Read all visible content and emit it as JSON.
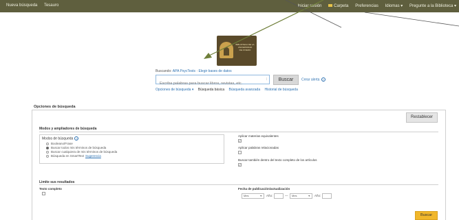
{
  "topbar": {
    "left": [
      "Nueva búsqueda",
      "Tesauro"
    ],
    "right": [
      "Carpeta",
      "Preferencias",
      "Idiomas",
      "Pregunte a la Biblioteca"
    ],
    "right_lead": "Iniciar sesión"
  },
  "logo": {
    "lines": [
      "BIBLIOTECA DE LA",
      "UNIVERSIDAD",
      "DE OVIEDO"
    ]
  },
  "search": {
    "buscando_label": "Buscando:",
    "db_name": "APA PsycTests",
    "choose_db": "Elegir bases de datos",
    "placeholder": "Escriba palabras para buscar libros, revistas, etc.",
    "button": "Buscar",
    "create_alert": "Crear alerta",
    "options": [
      "Opciones de búsqueda",
      "Búsqueda básica",
      "Búsqueda avanzada",
      "Historial de búsqueda"
    ]
  },
  "panel": {
    "title": "Opciones de búsqueda",
    "reset": "Restablecer",
    "modes_section": "Modos y ampliadores de búsqueda",
    "modes_box_title": "Modos de búsqueda",
    "modes": [
      {
        "label": "Booleano/Frase",
        "selected": false
      },
      {
        "label": "Buscar todos mis términos de búsqueda",
        "selected": true
      },
      {
        "label": "Buscar cualquiera de mis términos de búsqueda",
        "selected": false
      },
      {
        "label": "Búsqueda en SmartText",
        "selected": false,
        "link": "Sugerencia"
      }
    ],
    "expanders": [
      {
        "label": "Aplicar materias equivalentes",
        "checked": true
      },
      {
        "label": "Aplicar palabras relacionadas",
        "checked": false
      },
      {
        "label": "Buscar también dentro del texto completo de los artículos",
        "checked": true
      }
    ],
    "limits_section": "Limite sus resultados",
    "full_text": "Texto completo",
    "pub_date": "Fecha de publicación/actualización",
    "month_placeholder": "Mes",
    "year_label": "Año:",
    "dash": "—",
    "search_button": "Buscar"
  }
}
